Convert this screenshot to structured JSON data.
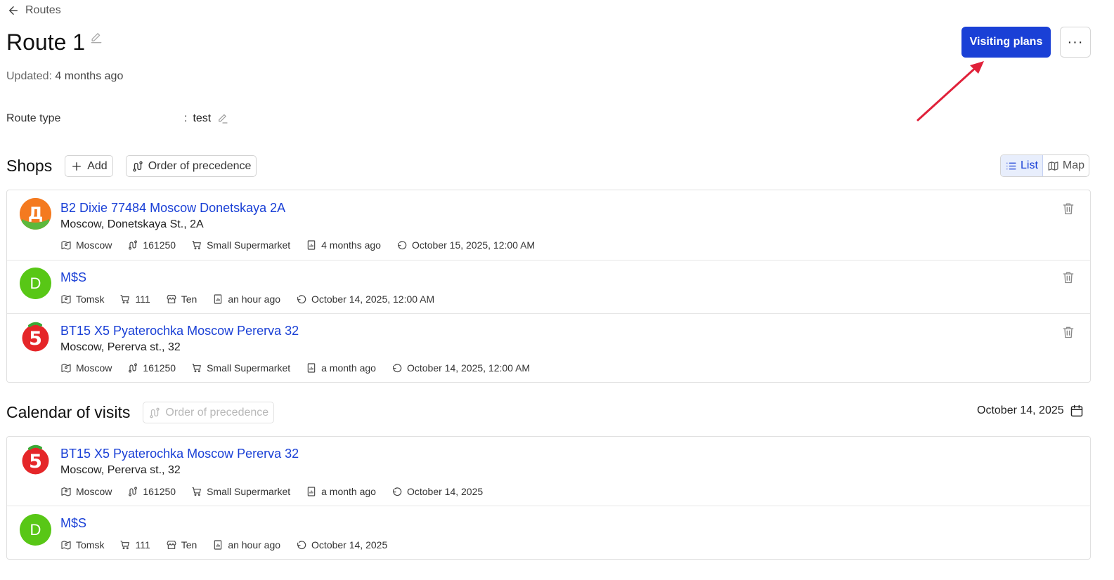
{
  "back": {
    "label": "Routes"
  },
  "header": {
    "title": "Route 1",
    "updated_label": "Updated:",
    "updated_value": "4 months ago",
    "route_type_label": "Route type",
    "route_type_colon": ":",
    "route_type_value": "test",
    "visiting_plans_label": "Visiting plans",
    "more_label": "···"
  },
  "shops": {
    "title": "Shops",
    "add_label": "Add",
    "order_label": "Order of precedence",
    "view_list_label": "List",
    "view_map_label": "Map",
    "items": [
      {
        "avatar": "Д",
        "name": "B2 Dixie 77484 Moscow Donetskaya 2A",
        "address": "Moscow, Donetskaya St., 2A",
        "city": "Moscow",
        "code": "161250",
        "format": "Small Supermarket",
        "updated": "4 months ago",
        "visit": "October 15, 2025, 12:00 AM"
      },
      {
        "avatar": "D",
        "name": "M$S",
        "city": "Tomsk",
        "format": "111",
        "segment": "Ten",
        "updated": "an hour ago",
        "visit": "October 14, 2025, 12:00 AM"
      },
      {
        "avatar": "5",
        "name": "BT15 X5 Pyaterochka Moscow Pererva 32",
        "address": "Moscow, Pererva st., 32",
        "city": "Moscow",
        "code": "161250",
        "format": "Small Supermarket",
        "updated": "a month ago",
        "visit": "October 14, 2025, 12:00 AM"
      }
    ]
  },
  "calendar": {
    "title": "Calendar of visits",
    "order_label": "Order of precedence",
    "date": "October 14, 2025",
    "items": [
      {
        "avatar": "5",
        "name": "BT15 X5 Pyaterochka Moscow Pererva 32",
        "address": "Moscow, Pererva st., 32",
        "city": "Moscow",
        "code": "161250",
        "format": "Small Supermarket",
        "updated": "a month ago",
        "visit": "October 14, 2025"
      },
      {
        "avatar": "D",
        "name": "M$S",
        "city": "Tomsk",
        "format": "111",
        "segment": "Ten",
        "updated": "an hour ago",
        "visit": "October 14, 2025"
      }
    ]
  },
  "colors": {
    "accent": "#1a40d6",
    "annotation_arrow": "#e0213a",
    "avatar_green": "#58c716",
    "dixie_orange": "#f47a20",
    "pyaterochka_red": "#e52629"
  }
}
